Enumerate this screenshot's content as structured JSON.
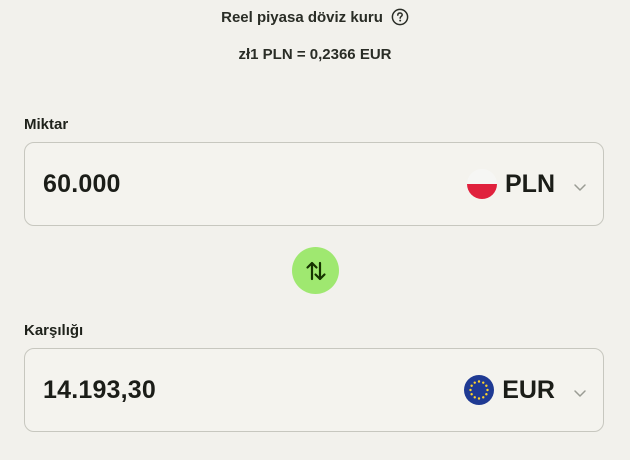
{
  "header": {
    "rate_title": "Reel piyasa döviz kuru",
    "rate_value": "zł1 PLN = 0,2366 EUR"
  },
  "send": {
    "label": "Miktar",
    "amount": "60.000",
    "currency": "PLN",
    "flag_icon": "poland-flag-icon"
  },
  "swap": {
    "icon": "swap-arrows-icon",
    "color": "#9fe870"
  },
  "receive": {
    "label": "Karşılığı",
    "amount": "14.193,30",
    "currency": "EUR",
    "flag_icon": "eu-flag-icon"
  },
  "icons": {
    "help": "help-circle-icon",
    "dropdown": "chevron-down-icon"
  }
}
